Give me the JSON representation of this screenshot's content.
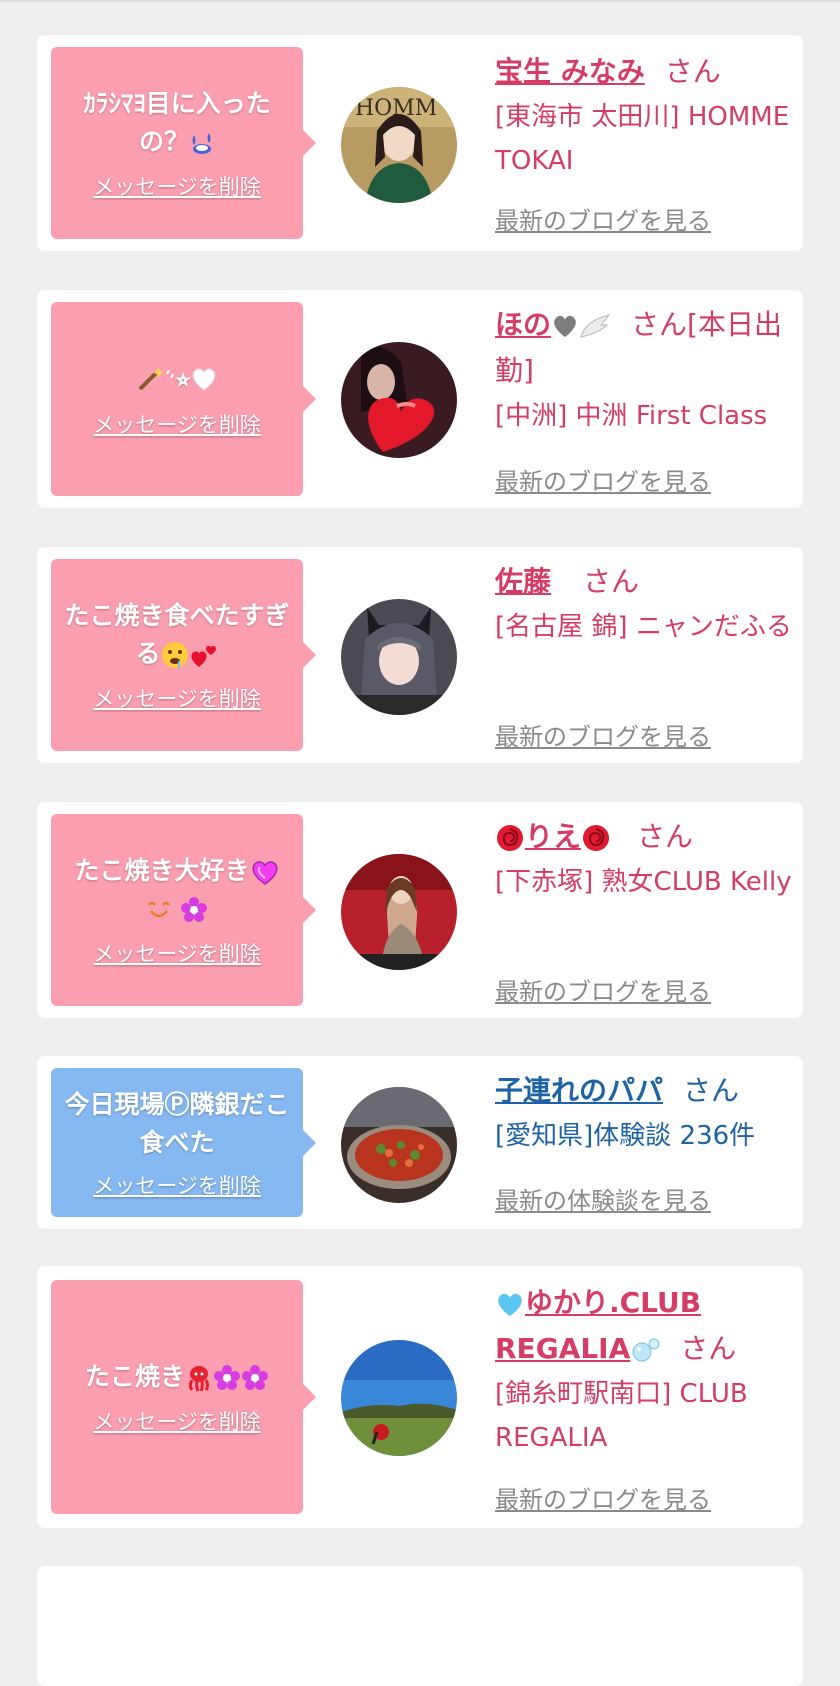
{
  "colors": {
    "accent_pink": "#d53d67",
    "accent_blue": "#1d63a6",
    "bubble_pink": "#fb9eb0",
    "bubble_blue": "#86b9f2",
    "link_gray": "#8a8a8a",
    "background": "#efefef"
  },
  "common": {
    "delete_label": "メッセージを削除",
    "honorific": "さん"
  },
  "cards": [
    {
      "message": "ｶﾗｼﾏﾖ目に入ったの？",
      "message_icons": [
        "sweat-drops-icon"
      ],
      "name": "宝生 みなみ",
      "shop": "[東海市 太田川] HOMME TOKAI",
      "link": "最新のブログを見る"
    },
    {
      "message": "",
      "message_icons": [
        "magic-wand-icon",
        "sparkle-icon",
        "star-icon",
        "white-heart-icon"
      ],
      "message_glyph": "⭐︎",
      "name": "ほの",
      "name_icons": [
        "gray-heart-icon",
        "wing-icon"
      ],
      "name_suffix": "さん[本日出勤]",
      "shop": "[中洲] 中洲 First Class",
      "link": "最新のブログを見る"
    },
    {
      "message": "たこ焼き食べたすぎる",
      "message_icons": [
        "drooling-face-icon",
        "red-hearts-icon"
      ],
      "name": "佐藤",
      "shop": "[名古屋 錦] ニャンだふる",
      "link": "最新のブログを見る"
    },
    {
      "message": "たこ焼き大好き",
      "message_icons": [
        "purple-heart-icon",
        "smile-icon",
        "flower-icon"
      ],
      "name": "りえ",
      "name_icons": [
        "rose-icon",
        "rose-icon"
      ],
      "shop": "[下赤塚] 熟女CLUB Kelly",
      "link": "最新のブログを見る"
    },
    {
      "message": "今日現場Ⓟ隣銀だこ食べた",
      "name": "子連れのパパ",
      "shop": "[愛知県]体験談 236件",
      "link": "最新の体験談を見る"
    },
    {
      "message": "たこ焼き",
      "message_icons": [
        "octopus-icon",
        "flower-icon",
        "flower-icon"
      ],
      "name": "ゆかり.CLUB REGALIA",
      "name_icons": [
        "blue-heart-icon",
        "bubbles-icon"
      ],
      "shop": "[錦糸町駅南口] CLUB REGALIA",
      "link": "最新のブログを見る"
    }
  ]
}
